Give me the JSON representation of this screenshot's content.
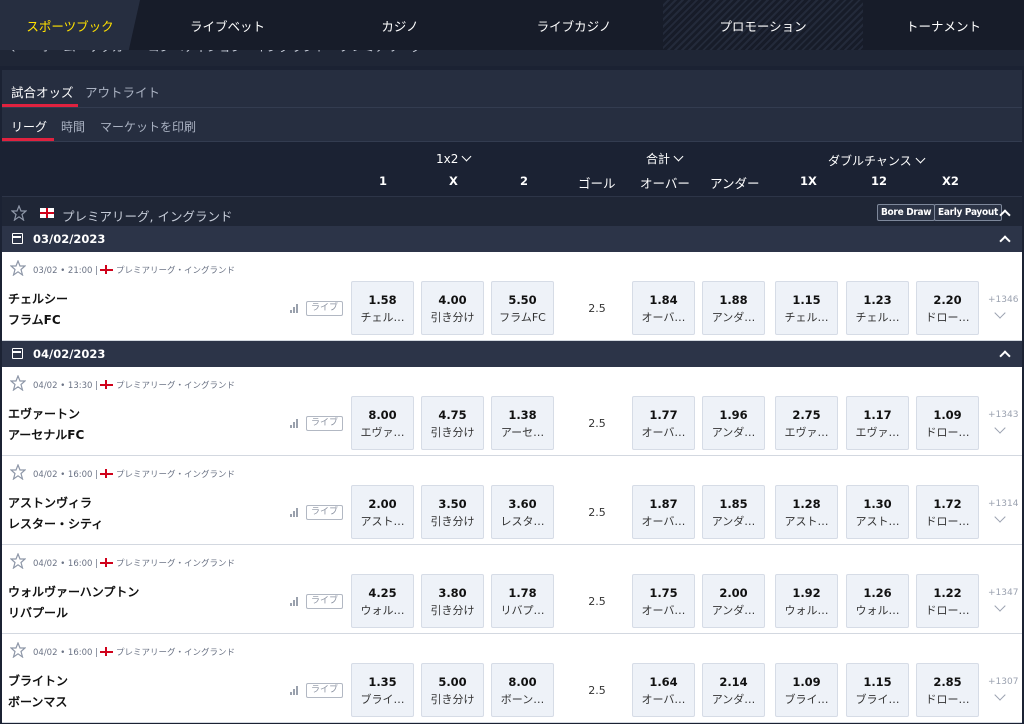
{
  "nav": {
    "tabs": [
      "スポーツブック",
      "ライブベット",
      "カジノ",
      "ライブカジノ",
      "プロモーション",
      "トーナメント"
    ]
  },
  "breadcrumb": "ホーム・サッカー・コンペティション・イングランド・プレミアリーグ",
  "tabs": {
    "odds": "試合オッズ",
    "outright": "アウトライト"
  },
  "filters": {
    "league": "リーグ",
    "time": "時間",
    "print": "マーケットを印刷"
  },
  "columns": {
    "group_1x2": "1x2",
    "group_total": "合計",
    "group_double": "ダブルチャンス",
    "c1": "1",
    "cx": "X",
    "c2": "2",
    "goal": "ゴール",
    "over": "オーバー",
    "under": "アンダー",
    "d1x": "1X",
    "d12": "12",
    "dx2": "X2"
  },
  "league": {
    "name": "プレミアリーグ, イングランド",
    "bore_draw": "Bore Draw",
    "early_payout": "Early Payout"
  },
  "live_label": "ライブ",
  "days": [
    {
      "date": "03/02/2023"
    },
    {
      "date": "04/02/2023"
    }
  ],
  "matches": [
    {
      "meta": "03/02 • 21:00 |",
      "league": "プレミアリーグ・イングランド",
      "home": "チェルシー",
      "away": "フラムFC",
      "odds": [
        [
          "1.58",
          "チェル…"
        ],
        [
          "4.00",
          "引き分け"
        ],
        [
          "5.50",
          "フラムFC"
        ]
      ],
      "goal": "2.5",
      "totals": [
        [
          "1.84",
          "オーバ…"
        ],
        [
          "1.88",
          "アンダ…"
        ]
      ],
      "double": [
        [
          "1.15",
          "チェル…"
        ],
        [
          "1.23",
          "チェル…"
        ],
        [
          "2.20",
          "ドロー…"
        ]
      ],
      "more": "+1346"
    },
    {
      "meta": "04/02 • 13:30 |",
      "league": "プレミアリーグ・イングランド",
      "home": "エヴァートン",
      "away": "アーセナルFC",
      "odds": [
        [
          "8.00",
          "エヴァ…"
        ],
        [
          "4.75",
          "引き分け"
        ],
        [
          "1.38",
          "アーセ…"
        ]
      ],
      "goal": "2.5",
      "totals": [
        [
          "1.77",
          "オーバ…"
        ],
        [
          "1.96",
          "アンダ…"
        ]
      ],
      "double": [
        [
          "2.75",
          "エヴァ…"
        ],
        [
          "1.17",
          "エヴァ…"
        ],
        [
          "1.09",
          "ドロー…"
        ]
      ],
      "more": "+1343"
    },
    {
      "meta": "04/02 • 16:00 |",
      "league": "プレミアリーグ・イングランド",
      "home": "アストンヴィラ",
      "away": "レスター・シティ",
      "odds": [
        [
          "2.00",
          "アスト…"
        ],
        [
          "3.50",
          "引き分け"
        ],
        [
          "3.60",
          "レスタ…"
        ]
      ],
      "goal": "2.5",
      "totals": [
        [
          "1.87",
          "オーバ…"
        ],
        [
          "1.85",
          "アンダ…"
        ]
      ],
      "double": [
        [
          "1.28",
          "アスト…"
        ],
        [
          "1.30",
          "アスト…"
        ],
        [
          "1.72",
          "ドロー…"
        ]
      ],
      "more": "+1314"
    },
    {
      "meta": "04/02 • 16:00 |",
      "league": "プレミアリーグ・イングランド",
      "home": "ウォルヴァーハンプトン",
      "away": "リバプール",
      "odds": [
        [
          "4.25",
          "ウォル…"
        ],
        [
          "3.80",
          "引き分け"
        ],
        [
          "1.78",
          "リバプ…"
        ]
      ],
      "goal": "2.5",
      "totals": [
        [
          "1.75",
          "オーバ…"
        ],
        [
          "2.00",
          "アンダ…"
        ]
      ],
      "double": [
        [
          "1.92",
          "ウォル…"
        ],
        [
          "1.26",
          "ウォル…"
        ],
        [
          "1.22",
          "ドロー…"
        ]
      ],
      "more": "+1347"
    },
    {
      "meta": "04/02 • 16:00 |",
      "league": "プレミアリーグ・イングランド",
      "home": "ブライトン",
      "away": "ボーンマス",
      "odds": [
        [
          "1.35",
          "ブライ…"
        ],
        [
          "5.00",
          "引き分け"
        ],
        [
          "8.00",
          "ボーン…"
        ]
      ],
      "goal": "2.5",
      "totals": [
        [
          "1.64",
          "オーバ…"
        ],
        [
          "2.14",
          "アンダ…"
        ]
      ],
      "double": [
        [
          "1.09",
          "ブライ…"
        ],
        [
          "1.15",
          "ブライ…"
        ],
        [
          "2.85",
          "ドロー…"
        ]
      ],
      "more": "+1307"
    }
  ]
}
